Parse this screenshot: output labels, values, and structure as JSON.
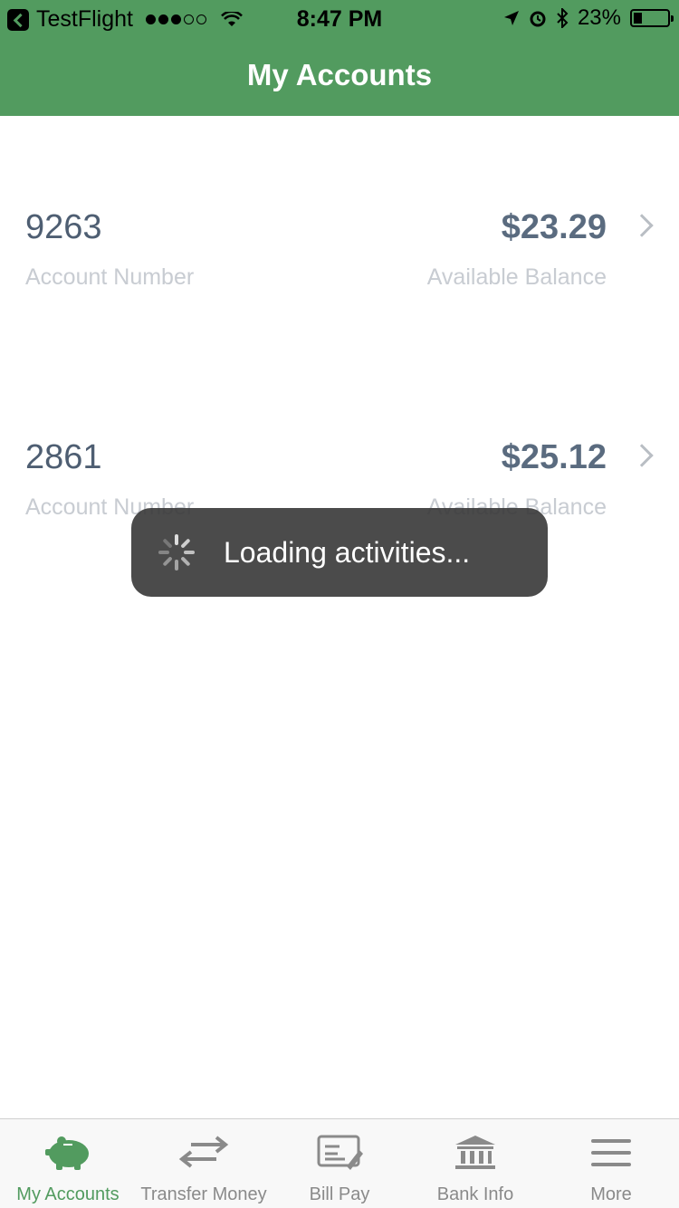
{
  "status_bar": {
    "back_app": "TestFlight",
    "time": "8:47 PM",
    "battery": "23%"
  },
  "nav": {
    "title": "My Accounts"
  },
  "accounts": [
    {
      "number": "9263",
      "number_label": "Account Number",
      "balance": "$23.29",
      "balance_label": "Available Balance"
    },
    {
      "number": "2861",
      "number_label": "Account Number",
      "balance": "$25.12",
      "balance_label": "Available Balance"
    }
  ],
  "toast": {
    "text": "Loading activities..."
  },
  "tabs": [
    {
      "label": "My Accounts",
      "icon": "piggy-bank-icon",
      "active": true
    },
    {
      "label": "Transfer Money",
      "icon": "transfer-arrows-icon",
      "active": false
    },
    {
      "label": "Bill Pay",
      "icon": "check-icon",
      "active": false
    },
    {
      "label": "Bank Info",
      "icon": "bank-icon",
      "active": false
    },
    {
      "label": "More",
      "icon": "menu-icon",
      "active": false
    }
  ],
  "colors": {
    "accent": "#529b5f",
    "text_primary": "#4e5e72",
    "label": "#c8ccd2",
    "tab_inactive": "#8a8a8a"
  }
}
